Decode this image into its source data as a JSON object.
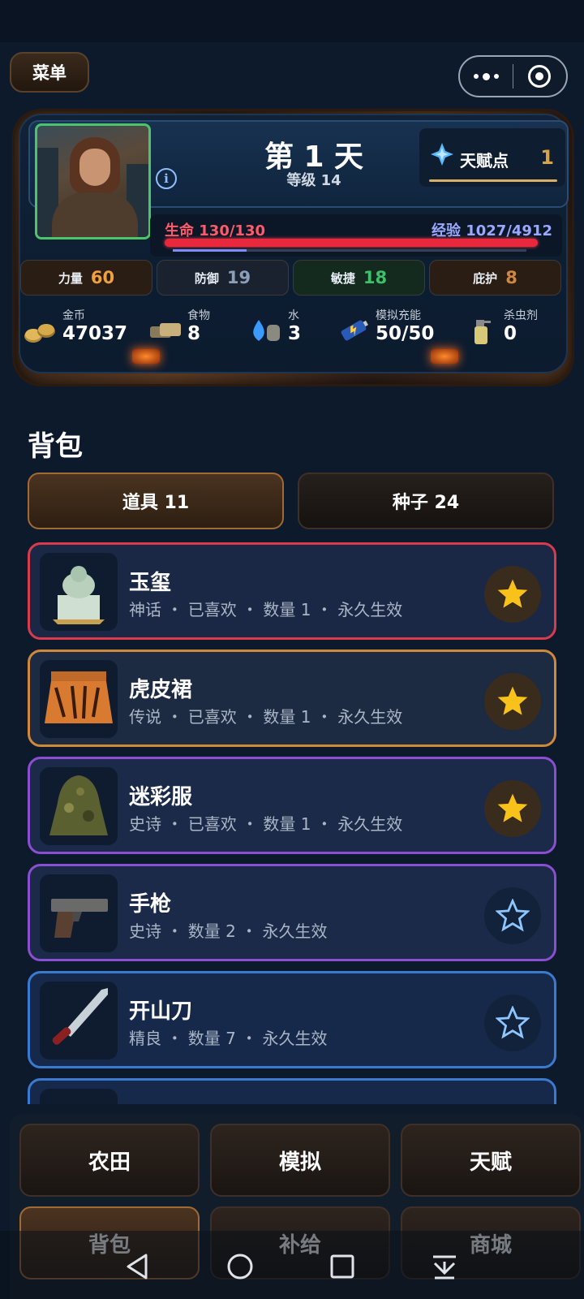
{
  "top_bar": {
    "menu_label": "菜单"
  },
  "status": {
    "day_title": "第 1 天",
    "level": "等级 14",
    "talent_label": "天赋点",
    "talent_value": "1",
    "hp_label": "生命 130/130",
    "exp_label": "经验 1027/4912",
    "hp_fraction": 1.0,
    "exp_fraction": 0.209,
    "stats": [
      {
        "name": "力量",
        "value": "60",
        "color": "#f0a040"
      },
      {
        "name": "防御",
        "value": "19",
        "color": "#8aa0b8"
      },
      {
        "name": "敏捷",
        "value": "18",
        "color": "#3ec06a"
      },
      {
        "name": "庇护",
        "value": "8",
        "color": "#d08840"
      }
    ],
    "resources": [
      {
        "label": "金币",
        "value": "47037",
        "icon": "coins-icon"
      },
      {
        "label": "食物",
        "value": "8",
        "icon": "food-icon"
      },
      {
        "label": "水",
        "value": "3",
        "icon": "water-icon"
      },
      {
        "label": "模拟充能",
        "value": "50/50",
        "icon": "battery-icon"
      },
      {
        "label": "杀虫剂",
        "value": "0",
        "icon": "spray-icon"
      }
    ]
  },
  "backpack": {
    "title": "背包",
    "tabs": [
      {
        "label": "道具 11",
        "active": true
      },
      {
        "label": "种子 24",
        "active": false
      }
    ],
    "items": [
      {
        "name": "玉玺",
        "desc": "神话 ・ 已喜欢 ・ 数量 1 ・ 永久生效",
        "rarity_color": "#d83a4e",
        "favorited": true,
        "icon": "jade-seal-icon"
      },
      {
        "name": "虎皮裙",
        "desc": "传说 ・ 已喜欢 ・ 数量 1 ・ 永久生效",
        "rarity_color": "#d0883a",
        "favorited": true,
        "icon": "tiger-skirt-icon"
      },
      {
        "name": "迷彩服",
        "desc": "史诗 ・ 已喜欢 ・ 数量 1 ・ 永久生效",
        "rarity_color": "#8a4ed0",
        "favorited": true,
        "icon": "camouflage-suit-icon"
      },
      {
        "name": "手枪",
        "desc": "史诗 ・ 数量 2 ・ 永久生效",
        "rarity_color": "#8a4ed0",
        "favorited": false,
        "icon": "pistol-icon"
      },
      {
        "name": "开山刀",
        "desc": "精良 ・ 数量 7 ・ 永久生效",
        "rarity_color": "#3a7ad0",
        "favorited": false,
        "icon": "machete-icon"
      },
      {
        "name": "",
        "desc": "",
        "rarity_color": "#3a7ad0",
        "favorited": false,
        "icon": "item-icon"
      }
    ]
  },
  "bottom_nav": [
    {
      "label": "农田",
      "active": false
    },
    {
      "label": "模拟",
      "active": false
    },
    {
      "label": "天赋",
      "active": false
    },
    {
      "label": "背包",
      "active": true
    },
    {
      "label": "补给",
      "active": false
    },
    {
      "label": "商城",
      "active": false
    }
  ]
}
